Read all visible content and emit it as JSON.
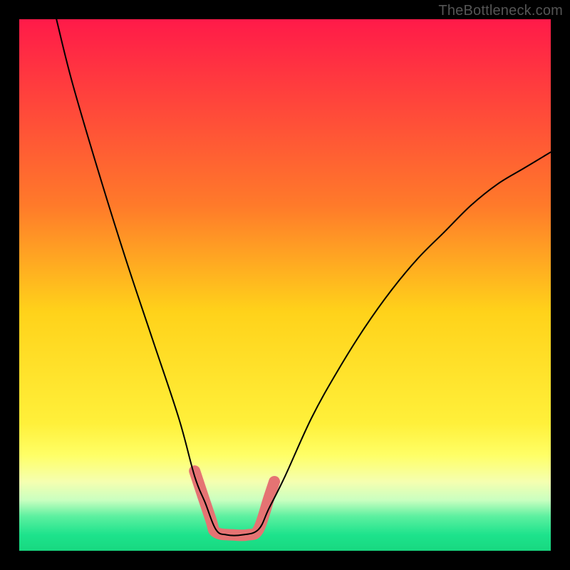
{
  "watermark": "TheBottleneck.com",
  "chart_data": {
    "type": "line",
    "title": "",
    "xlabel": "",
    "ylabel": "",
    "xlim": [
      0,
      100
    ],
    "ylim": [
      0,
      100
    ],
    "background_gradient": {
      "stops": [
        {
          "offset": 0,
          "color": "#ff1a49"
        },
        {
          "offset": 0.35,
          "color": "#ff7a2a"
        },
        {
          "offset": 0.55,
          "color": "#ffd21a"
        },
        {
          "offset": 0.76,
          "color": "#fff03a"
        },
        {
          "offset": 0.82,
          "color": "#ffff66"
        },
        {
          "offset": 0.87,
          "color": "#f5ffb0"
        },
        {
          "offset": 0.905,
          "color": "#c9ffc0"
        },
        {
          "offset": 0.935,
          "color": "#5df0a0"
        },
        {
          "offset": 0.97,
          "color": "#1de38c"
        },
        {
          "offset": 1.0,
          "color": "#18d880"
        }
      ]
    },
    "series": [
      {
        "name": "bottleneck-curve",
        "color": "#000000",
        "stroke_width": 2,
        "points": [
          {
            "x": 7,
            "y": 100
          },
          {
            "x": 10,
            "y": 88
          },
          {
            "x": 15,
            "y": 71
          },
          {
            "x": 20,
            "y": 55
          },
          {
            "x": 25,
            "y": 40
          },
          {
            "x": 30,
            "y": 25
          },
          {
            "x": 33,
            "y": 14
          },
          {
            "x": 35,
            "y": 9
          },
          {
            "x": 37,
            "y": 4
          },
          {
            "x": 39,
            "y": 3
          },
          {
            "x": 42,
            "y": 3
          },
          {
            "x": 45,
            "y": 4
          },
          {
            "x": 47,
            "y": 8
          },
          {
            "x": 50,
            "y": 14
          },
          {
            "x": 55,
            "y": 25
          },
          {
            "x": 60,
            "y": 34
          },
          {
            "x": 65,
            "y": 42
          },
          {
            "x": 70,
            "y": 49
          },
          {
            "x": 75,
            "y": 55
          },
          {
            "x": 80,
            "y": 60
          },
          {
            "x": 85,
            "y": 65
          },
          {
            "x": 90,
            "y": 69
          },
          {
            "x": 95,
            "y": 72
          },
          {
            "x": 100,
            "y": 75
          }
        ]
      },
      {
        "name": "highlight-segment",
        "color": "#e57373",
        "stroke_width": 16,
        "points": [
          {
            "x": 33,
            "y": 15
          },
          {
            "x": 36,
            "y": 6
          },
          {
            "x": 37,
            "y": 3.5
          },
          {
            "x": 40,
            "y": 3
          },
          {
            "x": 43,
            "y": 3
          },
          {
            "x": 45,
            "y": 4
          },
          {
            "x": 47,
            "y": 10
          },
          {
            "x": 48,
            "y": 13
          }
        ]
      }
    ]
  }
}
